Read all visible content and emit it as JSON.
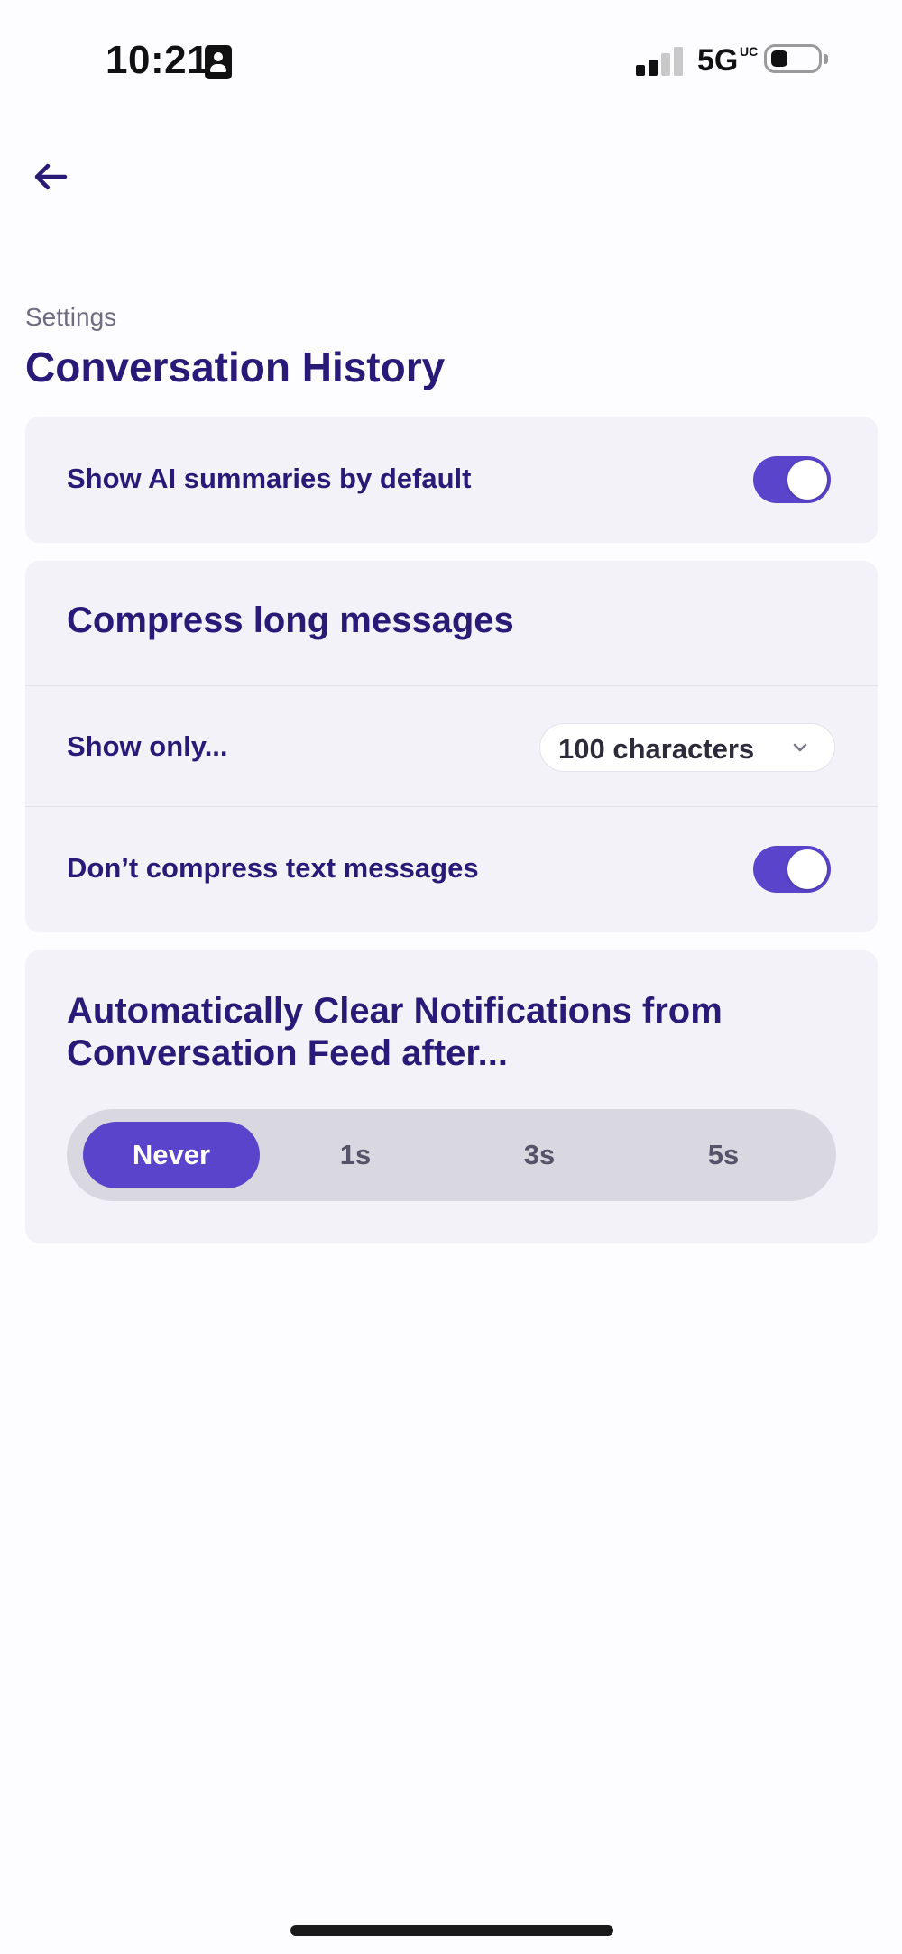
{
  "status_bar": {
    "time": "10:21",
    "network": "5G",
    "network_badge": "UC",
    "icons": [
      "contact-card-icon",
      "signal-icon",
      "battery-icon"
    ]
  },
  "nav": {
    "back_icon": "arrow-left-icon"
  },
  "header": {
    "breadcrumb": "Settings",
    "title": "Conversation History"
  },
  "ai_summaries": {
    "label": "Show AI summaries by default",
    "enabled": true
  },
  "compress": {
    "title": "Compress long messages",
    "show_only_label": "Show only...",
    "show_only_value": "100 characters",
    "text_messages_label": "Don’t compress text messages",
    "text_messages_enabled": true
  },
  "auto_clear": {
    "title_line1": "Automatically Clear Notifications from",
    "title_line2": "Conversation Feed after...",
    "options": [
      "Never",
      "1s",
      "3s",
      "5s"
    ],
    "selected": "Never"
  },
  "colors": {
    "accent": "#5a44cc",
    "title": "#2a1a78",
    "card": "#f3f2f8",
    "segment_track": "#d9d8e0"
  }
}
